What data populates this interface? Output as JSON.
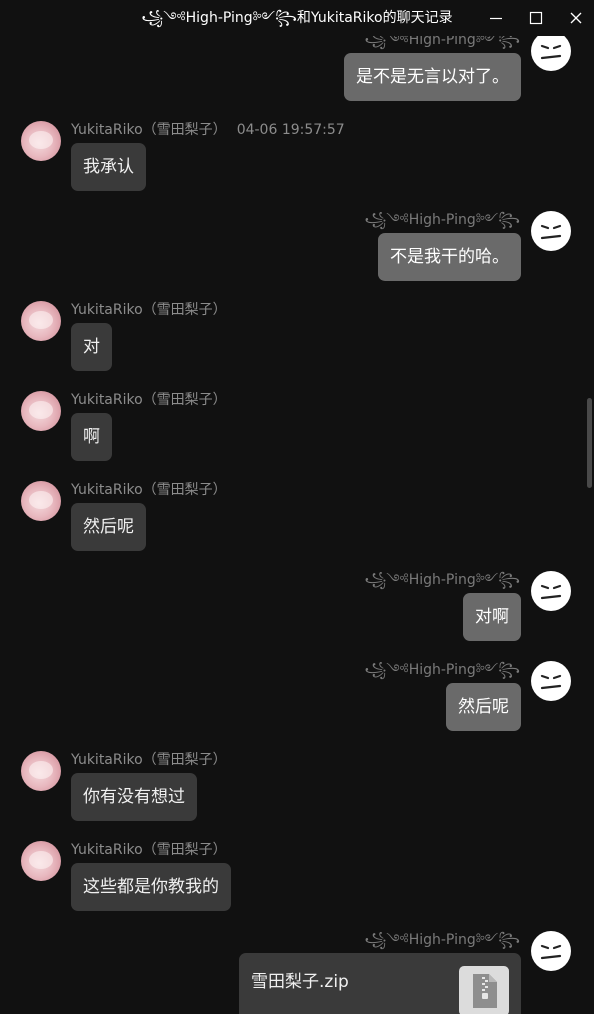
{
  "window": {
    "title": "꧁༺High-Ping༻꧂和YukitaRiko的聊天记录"
  },
  "self_name": "꧁༺High-Ping༻꧂",
  "other_name": "YukitaRiko（雪田梨子）",
  "messages": [
    {
      "from": "self",
      "text": "是不是无言以对了。"
    },
    {
      "from": "other",
      "timestamp": "04-06 19:57:57",
      "text": "我承认"
    },
    {
      "from": "self",
      "text": "不是我干的哈。"
    },
    {
      "from": "other",
      "text": "对"
    },
    {
      "from": "other",
      "text": "啊"
    },
    {
      "from": "other",
      "text": "然后呢"
    },
    {
      "from": "self",
      "text": "对啊"
    },
    {
      "from": "self",
      "text": "然后呢"
    },
    {
      "from": "other",
      "text": "你有没有想过"
    },
    {
      "from": "other",
      "text": "这些都是你教我的"
    },
    {
      "from": "self",
      "type": "file",
      "file_name": "雪田梨子.zip",
      "icon": "zip-file-icon"
    }
  ]
}
